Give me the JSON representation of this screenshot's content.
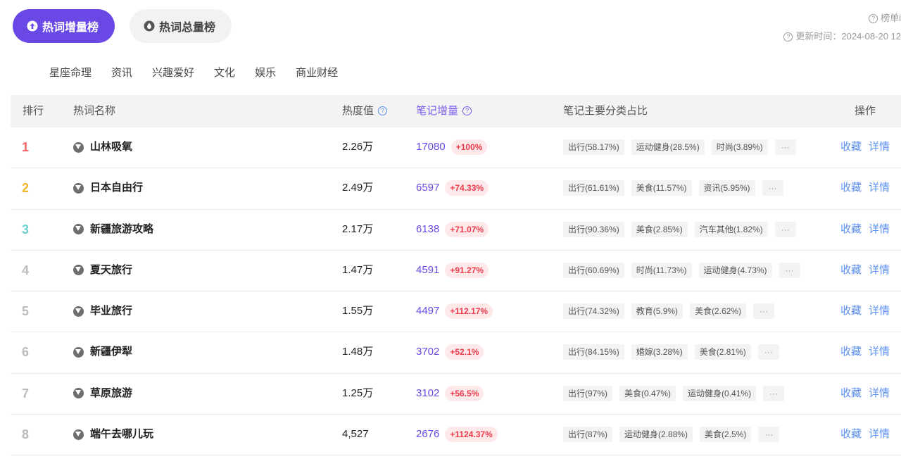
{
  "tabs": [
    {
      "label": "热词增量榜",
      "icon": "arrow-up-circle-icon",
      "active": true
    },
    {
      "label": "热词总量榜",
      "icon": "drop-circle-icon",
      "active": false
    }
  ],
  "info": {
    "rule_label": "榜单i",
    "update_label": "更新时间：2024-08-20 12"
  },
  "categories": [
    "星座命理",
    "资讯",
    "兴趣爱好",
    "文化",
    "娱乐",
    "商业财经"
  ],
  "table": {
    "headers": {
      "rank": "排行",
      "keyword": "热词名称",
      "heat": "热度值",
      "increase": "笔记增量",
      "category_ratio": "笔记主要分类占比",
      "actions": "操作"
    },
    "rows": [
      {
        "rank": "1",
        "keyword": "山林吸氧",
        "heat": "2.26万",
        "increase": "17080",
        "pct": "+100%",
        "tags": [
          "出行(58.17%)",
          "运动健身(28.5%)",
          "时尚(3.89%)"
        ]
      },
      {
        "rank": "2",
        "keyword": "日本自由行",
        "heat": "2.49万",
        "increase": "6597",
        "pct": "+74.33%",
        "tags": [
          "出行(61.61%)",
          "美食(11.57%)",
          "资讯(5.95%)"
        ]
      },
      {
        "rank": "3",
        "keyword": "新疆旅游攻略",
        "heat": "2.17万",
        "increase": "6138",
        "pct": "+71.07%",
        "tags": [
          "出行(90.36%)",
          "美食(2.85%)",
          "汽车其他(1.82%)"
        ]
      },
      {
        "rank": "4",
        "keyword": "夏天旅行",
        "heat": "1.47万",
        "increase": "4591",
        "pct": "+91.27%",
        "tags": [
          "出行(60.69%)",
          "时尚(11.73%)",
          "运动健身(4.73%)"
        ]
      },
      {
        "rank": "5",
        "keyword": "毕业旅行",
        "heat": "1.55万",
        "increase": "4497",
        "pct": "+112.17%",
        "tags": [
          "出行(74.32%)",
          "教育(5.9%)",
          "美食(2.62%)"
        ]
      },
      {
        "rank": "6",
        "keyword": "新疆伊犁",
        "heat": "1.48万",
        "increase": "3702",
        "pct": "+52.1%",
        "tags": [
          "出行(84.15%)",
          "婚嫁(3.28%)",
          "美食(2.81%)"
        ]
      },
      {
        "rank": "7",
        "keyword": "草原旅游",
        "heat": "1.25万",
        "increase": "3102",
        "pct": "+56.5%",
        "tags": [
          "出行(97%)",
          "美食(0.47%)",
          "运动健身(0.41%)"
        ]
      },
      {
        "rank": "8",
        "keyword": "端午去哪儿玩",
        "heat": "4,527",
        "increase": "2676",
        "pct": "+1124.37%",
        "tags": [
          "出行(87%)",
          "运动健身(2.88%)",
          "美食(2.5%)"
        ]
      }
    ],
    "more_label": "···",
    "action_collect": "收藏",
    "action_detail": "详情"
  },
  "colors": {
    "accent": "#6a48e6",
    "rank1": "#f36464",
    "rank2": "#f0b52a",
    "rank3": "#6dd0d0",
    "link": "#5b8ff0",
    "pct_text": "#ee3b4c"
  }
}
